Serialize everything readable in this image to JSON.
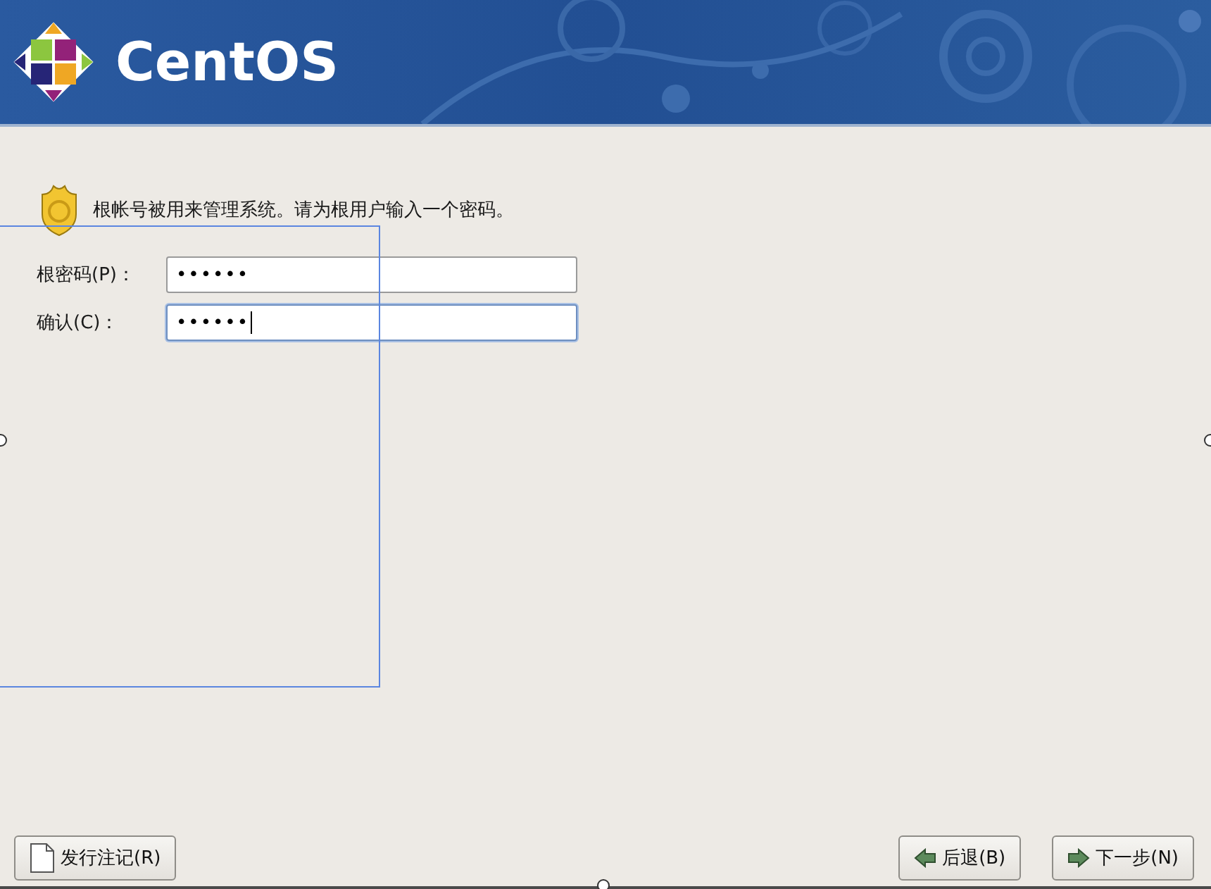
{
  "header": {
    "brand": "CentOS"
  },
  "message": "根帐号被用来管理系统。请为根用户输入一个密码。",
  "fields": [
    {
      "label": "根密码(P)：",
      "value": "••••••",
      "focused": false
    },
    {
      "label": "确认(C)：",
      "value": "••••••",
      "focused": true
    }
  ],
  "buttons": [
    {
      "label": "发行注记(R)",
      "kind": "notes"
    },
    {
      "label": "后退(B)",
      "kind": "back"
    },
    {
      "label": "下一步(N)",
      "kind": "next"
    }
  ]
}
